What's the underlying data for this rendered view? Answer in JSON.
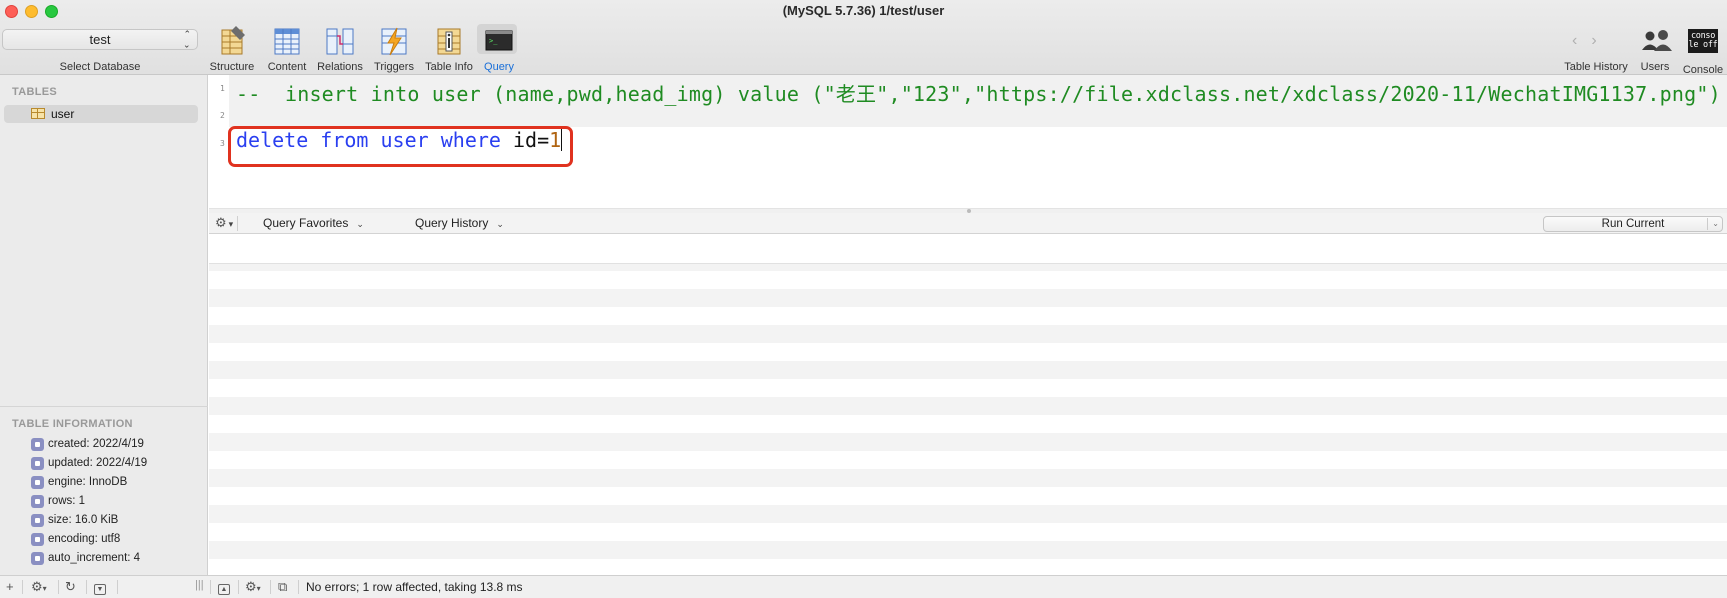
{
  "window": {
    "title": "(MySQL 5.7.36) 1/test/user"
  },
  "database": {
    "selected": "test",
    "select_label": "Select Database"
  },
  "toolbar": {
    "tabs": [
      "Structure",
      "Content",
      "Relations",
      "Triggers",
      "Table Info",
      "Query"
    ],
    "active_tab": "Query",
    "right": [
      "Table History",
      "Users",
      "Console"
    ],
    "console_icon_text": "conso le off"
  },
  "sidebar": {
    "tables_heading": "TABLES",
    "tables": [
      "user"
    ],
    "info_heading": "TABLE INFORMATION",
    "info": [
      "created: 2022/4/19",
      "updated: 2022/4/19",
      "engine: InnoDB",
      "rows: 1",
      "size: 16.0 KiB",
      "encoding: utf8",
      "auto_increment: 4"
    ]
  },
  "editor": {
    "line_numbers": [
      "1",
      "2",
      "3"
    ],
    "line1": "--  insert into user (name,pwd,head_img) value (\"老王\",\"123\",\"https://file.xdclass.net/xdclass/2020-11/WechatIMG1137.png\")",
    "line3": {
      "kw1": "delete",
      "kw2": "from",
      "kw3": "user",
      "kw4": "where",
      "ident": "id=",
      "number": "1"
    }
  },
  "query_bar": {
    "favorites": "Query Favorites",
    "history": "Query History",
    "run": "Run Current"
  },
  "status": {
    "message": "No errors; 1 row affected, taking 13.8 ms"
  },
  "colors": {
    "accent": "#1a6fd8",
    "highlight_box": "#e0321f",
    "comment": "#1f8b22",
    "keyword": "#2a3ff0",
    "number": "#b06412"
  }
}
